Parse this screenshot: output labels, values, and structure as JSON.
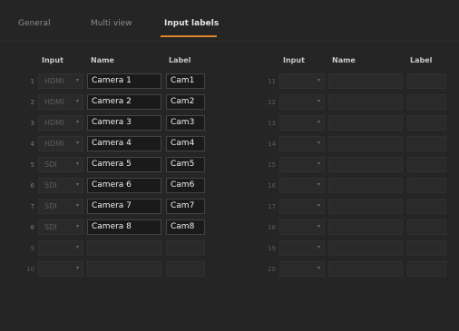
{
  "tabs": [
    "General",
    "Multi view",
    "Input labels"
  ],
  "active_tab": 2,
  "columns": {
    "input": "Input",
    "name": "Name",
    "label": "Label"
  },
  "icons": {
    "dropdown": "chevron-down-icon"
  },
  "colors": {
    "accent": "#e0842d",
    "background": "#252525"
  },
  "left_rows": [
    {
      "num": "1",
      "input": "HDMI",
      "name": "Camera 1",
      "label": "Cam1"
    },
    {
      "num": "2",
      "input": "HDMI",
      "name": "Camera 2",
      "label": "Cam2"
    },
    {
      "num": "3",
      "input": "HDMI",
      "name": "Camera 3",
      "label": "Cam3"
    },
    {
      "num": "4",
      "input": "HDMI",
      "name": "Camera 4",
      "label": "Cam4"
    },
    {
      "num": "5",
      "input": "SDI",
      "name": "Camera 5",
      "label": "Cam5"
    },
    {
      "num": "6",
      "input": "SDI",
      "name": "Camera 6",
      "label": "Cam6"
    },
    {
      "num": "7",
      "input": "SDI",
      "name": "Camera 7",
      "label": "Cam7"
    },
    {
      "num": "8",
      "input": "SDI",
      "name": "Camera 8",
      "label": "Cam8"
    },
    {
      "num": "9",
      "input": "",
      "name": "",
      "label": ""
    },
    {
      "num": "10",
      "input": "",
      "name": "",
      "label": ""
    }
  ],
  "right_rows": [
    {
      "num": "11",
      "input": "",
      "name": "",
      "label": ""
    },
    {
      "num": "12",
      "input": "",
      "name": "",
      "label": ""
    },
    {
      "num": "13",
      "input": "",
      "name": "",
      "label": ""
    },
    {
      "num": "14",
      "input": "",
      "name": "",
      "label": ""
    },
    {
      "num": "15",
      "input": "",
      "name": "",
      "label": ""
    },
    {
      "num": "16",
      "input": "",
      "name": "",
      "label": ""
    },
    {
      "num": "17",
      "input": "",
      "name": "",
      "label": ""
    },
    {
      "num": "18",
      "input": "",
      "name": "",
      "label": ""
    },
    {
      "num": "19",
      "input": "",
      "name": "",
      "label": ""
    },
    {
      "num": "20",
      "input": "",
      "name": "",
      "label": ""
    }
  ]
}
